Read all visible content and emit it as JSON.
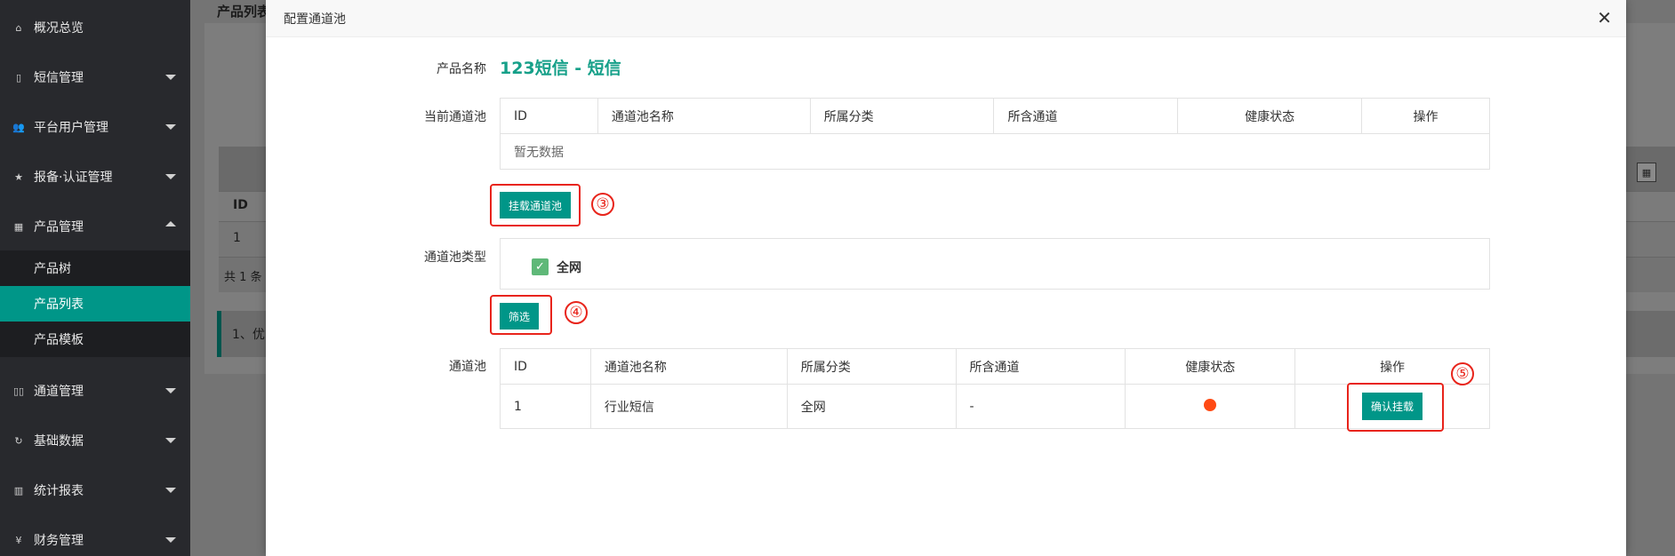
{
  "sidebar": {
    "items": [
      {
        "label": "概况总览",
        "icon": "home-icon"
      },
      {
        "label": "短信管理",
        "icon": "phone-icon"
      },
      {
        "label": "平台用户管理",
        "icon": "users-icon"
      },
      {
        "label": "报备·认证管理",
        "icon": "star-icon"
      },
      {
        "label": "产品管理",
        "icon": "grid-icon"
      },
      {
        "label": "通道管理",
        "icon": "columns-icon"
      },
      {
        "label": "基础数据",
        "icon": "refresh-icon"
      },
      {
        "label": "统计报表",
        "icon": "chart-icon"
      },
      {
        "label": "财务管理",
        "icon": "yen-icon"
      }
    ],
    "sub_items": [
      {
        "label": "产品树"
      },
      {
        "label": "产品列表"
      },
      {
        "label": "产品模板"
      }
    ]
  },
  "background": {
    "title": "产品列表",
    "table_header_id": "ID",
    "row_id": "1",
    "footer_count": "共 1 条",
    "tip": "1、优"
  },
  "modal": {
    "title": "配置通道池",
    "close": "✕",
    "product_name_label": "产品名称",
    "product_name": "123短信 - 短信",
    "current_pool_label": "当前通道池",
    "current_table": {
      "headers": [
        "ID",
        "通道池名称",
        "所属分类",
        "所含通道",
        "健康状态",
        "操作"
      ],
      "empty_text": "暂无数据"
    },
    "mount_button": "挂载通道池",
    "pool_type_label": "通道池类型",
    "pool_type_option": "全网",
    "filter_button": "筛选",
    "pool_label": "通道池",
    "pool_table": {
      "headers": [
        "ID",
        "通道池名称",
        "所属分类",
        "所含通道",
        "健康状态",
        "操作"
      ],
      "rows": [
        {
          "id": "1",
          "name": "行业短信",
          "category": "全网",
          "channels": "-",
          "health": "red",
          "action": "确认挂载"
        }
      ]
    },
    "annotations": [
      "③",
      "④",
      "⑤"
    ]
  },
  "colors": {
    "accent": "#009688",
    "product_name": "#16a089",
    "highlight": "#e8241b",
    "health_dot": "#ff4a14",
    "checkbox": "#5fb878"
  }
}
